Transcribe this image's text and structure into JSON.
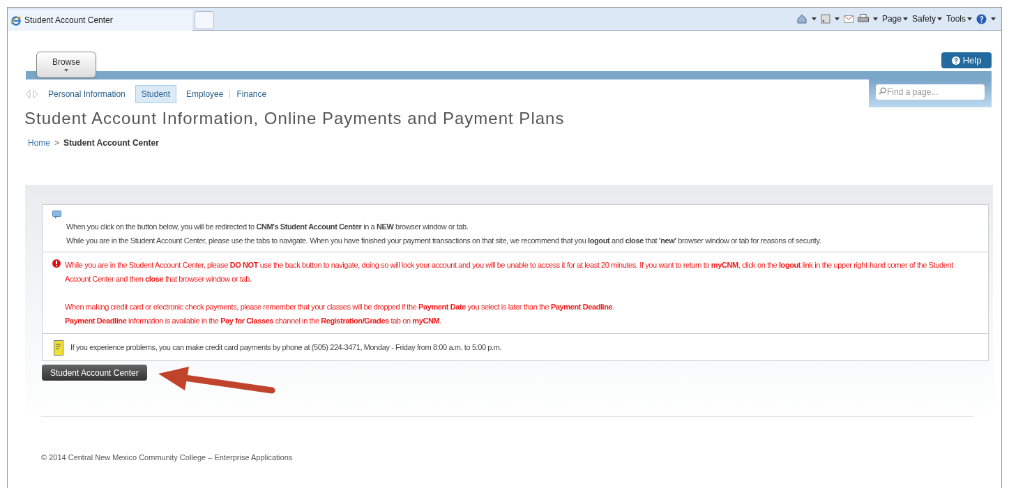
{
  "browser": {
    "tab_title": "Student Account Center",
    "menus": [
      "Page",
      "Safety",
      "Tools"
    ]
  },
  "header": {
    "browse_button": "Browse",
    "help_button": "Help",
    "search": {
      "placeholder": "Find a page..."
    }
  },
  "tabs": [
    {
      "label": "Personal Information",
      "selected": false
    },
    {
      "label": "Student",
      "selected": true
    },
    {
      "label": "Employee",
      "selected": false
    },
    {
      "label": "Finance",
      "selected": false
    }
  ],
  "title": "Student Account Information, Online Payments and Payment Plans",
  "breadcrumb": {
    "links": [
      "Home"
    ],
    "separator": ">",
    "current": "Student Account Center"
  },
  "notices": [
    {
      "kind": "info",
      "paragraphs": [
        "When you click on the button below, you will be redirected to **CNM's Student Account Center** in a **NEW** browser window or tab.",
        "While you are in the Student Account Center, please use the tabs to navigate. When you have finished your payment transactions on that site, we recommend that you **logout** and **close** that **'new'** browser window or tab for reasons of security."
      ]
    },
    {
      "kind": "warning",
      "paragraphs": [
        "While you are in the Student Account Center, please **DO NOT** use the back button to navigate, doing so will lock your account and you will be unable to access it for at least 20 minutes. If you want to return to **myCNM**, click on the **logout** link in the upper right-hand corner of the Student Account Center and then **close** that browser window or tab.",
        "When making credit card or electronic check payments, please remember that your classes will be dropped if the **Payment Date** you select is later than the **Payment Deadline**.",
        "**Payment Deadline** information is available in the **Pay for Classes** channel in the **Registration/Grades** tab on **myCNM**."
      ]
    },
    {
      "kind": "phone",
      "paragraphs": [
        "If you experience problems, you can make credit card payments by phone at (505) 224-3471, Monday - Friday from 8:00 a.m. to 5:00 p.m."
      ]
    }
  ],
  "action_button": "Student Account Center",
  "footer": "© 2014 Central New Mexico Community College – Enterprise Applications"
}
